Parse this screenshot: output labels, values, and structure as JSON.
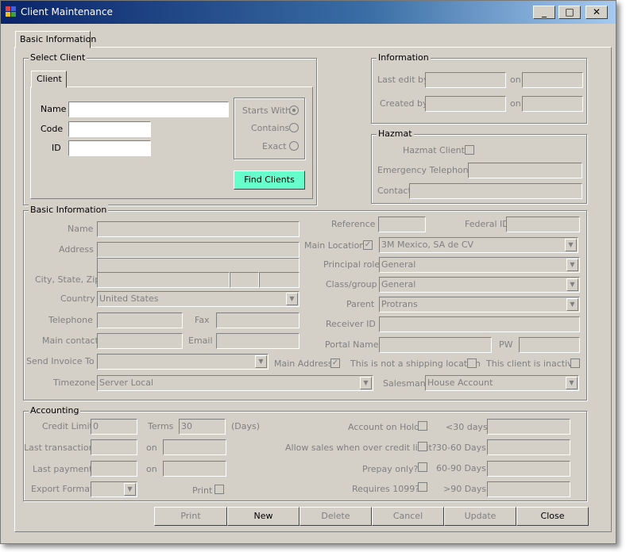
{
  "window": {
    "title": "Client Maintenance",
    "minimize": "_",
    "maximize": "□",
    "close": "✕"
  },
  "tabs": {
    "basic": "Basic Information"
  },
  "select_client": {
    "legend": "Select Client",
    "tab": "Client",
    "name_label": "Name",
    "code_label": "Code",
    "id_label": "ID",
    "name_value": "",
    "code_value": "",
    "id_value": "",
    "starts_with": "Starts With",
    "contains": "Contains",
    "exact": "Exact",
    "find_button": "Find Clients"
  },
  "information": {
    "legend": "Information",
    "last_edit_by": "Last edit by",
    "created_by": "Created by",
    "on1": "on",
    "on2": "on"
  },
  "hazmat": {
    "legend": "Hazmat",
    "client": "Hazmat Client?",
    "emergency": "Emergency Telephone",
    "contact": "Contact"
  },
  "basic": {
    "legend": "Basic Information",
    "name": "Name",
    "address": "Address",
    "city_state_zip": "City, State, Zip",
    "country": "Country",
    "country_value": "United States",
    "telephone": "Telephone",
    "fax": "Fax",
    "main_contact": "Main contact",
    "email": "Email",
    "send_invoice_to": "Send Invoice To",
    "main_address": "Main Address",
    "timezone": "Timezone",
    "timezone_value": "Server Local",
    "reference": "Reference",
    "federal_id": "Federal ID",
    "main_location": "Main Location",
    "main_location_value": "3M Mexico, SA de CV",
    "principal_role": "Principal role",
    "principal_role_value": "General",
    "class_group": "Class/group",
    "class_group_value": "General",
    "parent": "Parent",
    "parent_value": "Protrans",
    "receiver_id": "Receiver ID",
    "portal_name": "Portal Name",
    "pw": "PW",
    "not_shipping": "This is not a shipping location",
    "inactive": "This client is inactive",
    "salesman": "Salesman",
    "salesman_value": "House Account"
  },
  "accounting": {
    "legend": "Accounting",
    "credit_limit": "Credit Limit",
    "credit_limit_value": "0",
    "terms": "Terms",
    "terms_value": "30",
    "days": "(Days)",
    "last_transaction": "Last transaction",
    "last_payment": "Last payment",
    "on1": "on",
    "on2": "on",
    "export_format": "Export Format",
    "print": "Print",
    "on_hold": "Account on Hold",
    "allow_sales": "Allow sales when over credit limit?",
    "prepay": "Prepay only?",
    "requires_1099": "Requires 1099?",
    "lt30": "<30 days",
    "d30_60": "30-60 Days",
    "d60_90": "60-90 Days",
    "gt90": ">90 Days"
  },
  "buttons": {
    "print": "Print",
    "new": "New",
    "delete": "Delete",
    "cancel": "Cancel",
    "update": "Update",
    "close": "Close"
  },
  "colors": {
    "title_start": "#0a246a",
    "title_end": "#a6caf0",
    "face": "#d4d0c8",
    "find_button": "#66ffcc"
  }
}
